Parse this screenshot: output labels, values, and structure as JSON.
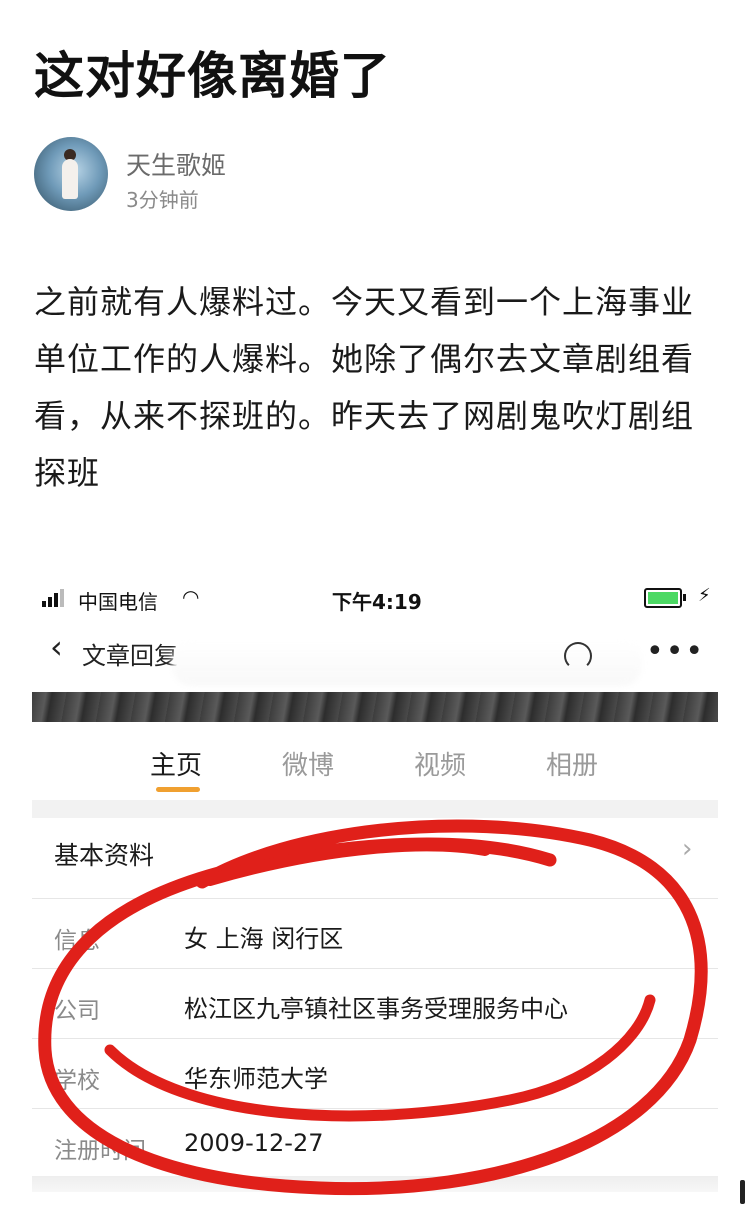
{
  "post": {
    "title": "这对好像离婚了",
    "author": "天生歌姬",
    "time": "3分钟前",
    "body": "之前就有人爆料过。今天又看到一个上海事业单位工作的人爆料。她除了偶尔去文章剧组看看，从来不探班的。昨天去了网剧鬼吹灯剧组探班"
  },
  "screenshot": {
    "status": {
      "carrier": "中国电信",
      "time": "下午4:19"
    },
    "nav": {
      "name": "文章回复"
    },
    "tabs": [
      {
        "label": "主页",
        "active": true
      },
      {
        "label": "微博",
        "active": false
      },
      {
        "label": "视频",
        "active": false
      },
      {
        "label": "相册",
        "active": false
      }
    ],
    "info_header": "基本资料",
    "rows": [
      {
        "label": "信息",
        "value": "女 上海 闵行区"
      },
      {
        "label": "公司",
        "value": "松江区九亭镇社区事务受理服务中心"
      },
      {
        "label": "学校",
        "value": "华东师范大学"
      },
      {
        "label": "注册时间",
        "value": "2009-12-27"
      }
    ],
    "accent_color": "#f0a030",
    "circle_color": "#e0201a"
  }
}
